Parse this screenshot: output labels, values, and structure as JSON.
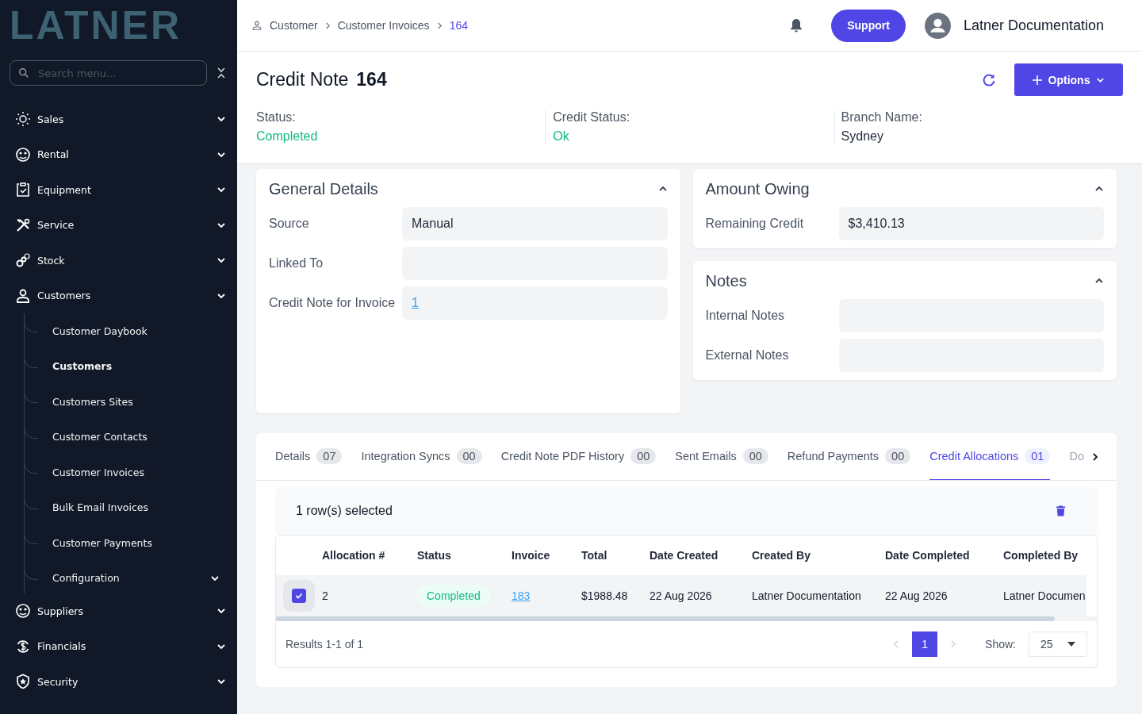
{
  "sidebar": {
    "logo": "LATNER",
    "search": {
      "placeholder": "Search menu..."
    },
    "items": [
      {
        "label": "Sales"
      },
      {
        "label": "Rental"
      },
      {
        "label": "Equipment"
      },
      {
        "label": "Service"
      },
      {
        "label": "Stock"
      },
      {
        "label": "Customers",
        "children": [
          {
            "label": "Customer Daybook",
            "selected": false
          },
          {
            "label": "Customers",
            "selected": true
          },
          {
            "label": "Customers Sites",
            "selected": false
          },
          {
            "label": "Customer Contacts",
            "selected": false
          },
          {
            "label": "Customer Invoices",
            "selected": false
          },
          {
            "label": "Bulk Email Invoices",
            "selected": false
          },
          {
            "label": "Customer Payments",
            "selected": false
          },
          {
            "label": "Configuration",
            "selected": false,
            "expandable": true
          }
        ]
      },
      {
        "label": "Suppliers"
      },
      {
        "label": "Financials"
      },
      {
        "label": "Security"
      }
    ]
  },
  "breadcrumb": [
    "Customer",
    "Customer Invoices",
    "164"
  ],
  "topbar": {
    "support": "Support",
    "user": "Latner Documentation"
  },
  "page": {
    "title": "Credit Note",
    "number": "164",
    "options": "Options",
    "summary": [
      {
        "label": "Status:",
        "value": "Completed",
        "kind": "good"
      },
      {
        "label": "Credit Status:",
        "value": "Ok",
        "kind": "good"
      },
      {
        "label": "Branch Name:",
        "value": "Sydney",
        "kind": "plain"
      }
    ]
  },
  "general": {
    "title": "General Details",
    "expanded": true,
    "fields": [
      {
        "label": "Source",
        "value": "Manual",
        "kind": "text"
      },
      {
        "label": "Linked To"
      },
      {
        "label": "Credit Note for Invoice",
        "value": "1",
        "kind": "link"
      }
    ]
  },
  "amount": {
    "title": "Amount Owing",
    "expanded": true,
    "fields": [
      {
        "label": "Remaining Credit",
        "value": "$3,410.13",
        "kind": "text"
      }
    ]
  },
  "notes": {
    "title": "Notes",
    "expanded": true,
    "fields": [
      {
        "label": "Internal Notes"
      },
      {
        "label": "External Notes"
      }
    ]
  },
  "tabs": [
    {
      "label": "Details",
      "count": "07",
      "selected": false
    },
    {
      "label": "Integration Syncs",
      "count": "00",
      "selected": false
    },
    {
      "label": "Credit Note PDF History",
      "count": "00",
      "selected": false
    },
    {
      "label": "Sent Emails",
      "count": "00",
      "selected": false
    },
    {
      "label": "Refund Payments",
      "count": "00",
      "selected": false
    },
    {
      "label": "Credit Allocations",
      "count": "01",
      "selected": true
    },
    {
      "label": "Do",
      "selected": false
    }
  ],
  "selection": "1 row(s) selected",
  "table": {
    "columns": [
      "Allocation #",
      "Status",
      "Invoice",
      "Total",
      "Date Created",
      "Created By",
      "Date Completed",
      "Completed By"
    ],
    "rows": [
      {
        "checked": true,
        "cells": [
          {
            "kind": "text",
            "text": "2"
          },
          {
            "kind": "badge",
            "text": "Completed"
          },
          {
            "kind": "link",
            "text": "183"
          },
          {
            "kind": "text",
            "text": "$1988.48"
          },
          {
            "kind": "text",
            "text": "22 Aug 2026"
          },
          {
            "kind": "text",
            "text": "Latner Documentation"
          },
          {
            "kind": "text",
            "text": "22 Aug 2026"
          },
          {
            "kind": "text",
            "text": "Latner Documen"
          }
        ]
      }
    ]
  },
  "footer": {
    "results": "Results 1-1 of 1",
    "pages": [
      {
        "label": "1",
        "selected": true
      }
    ],
    "show_label": "Show:",
    "page_size": "25"
  }
}
